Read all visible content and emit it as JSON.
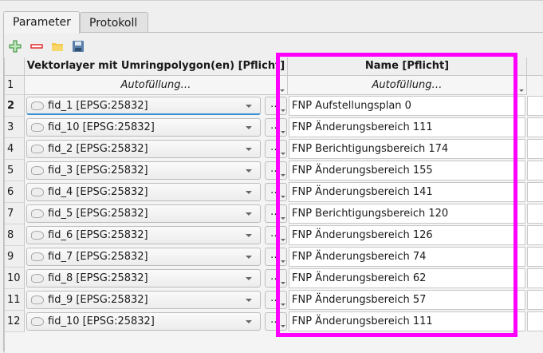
{
  "tabs": [
    {
      "label": "Parameter",
      "active": true
    },
    {
      "label": "Protokoll",
      "active": false
    }
  ],
  "toolbar": [
    {
      "icon": "add-icon",
      "color": "#3a9a3a"
    },
    {
      "icon": "remove-icon",
      "color": "#e03030"
    },
    {
      "icon": "open-folder-icon",
      "color": "#f2c94c"
    },
    {
      "icon": "save-icon",
      "color": "#5a7fa8"
    }
  ],
  "columns": [
    "Vektorlayer mit Umringpolygon(en) [Pflicht]",
    "Name [Pflicht]"
  ],
  "autofill": {
    "row_number": "1",
    "label": "Autofüllung…"
  },
  "ellipsis_label": "…",
  "highlight_color": "#ff00ff",
  "rows": [
    {
      "n": "2",
      "layer": "fid_1 [EPSG:25832]",
      "name": "FNP Aufstellungsplan 0"
    },
    {
      "n": "3",
      "layer": "fid_10 [EPSG:25832]",
      "name": "FNP Änderungsbereich 111"
    },
    {
      "n": "4",
      "layer": "fid_2 [EPSG:25832]",
      "name": "FNP Berichtigungsbereich 174"
    },
    {
      "n": "5",
      "layer": "fid_3 [EPSG:25832]",
      "name": "FNP Änderungsbereich 155"
    },
    {
      "n": "6",
      "layer": "fid_4 [EPSG:25832]",
      "name": "FNP Änderungsbereich 141"
    },
    {
      "n": "7",
      "layer": "fid_5 [EPSG:25832]",
      "name": "FNP Berichtigungsbereich 120"
    },
    {
      "n": "8",
      "layer": "fid_6 [EPSG:25832]",
      "name": "FNP Änderungsbereich 126"
    },
    {
      "n": "9",
      "layer": "fid_7 [EPSG:25832]",
      "name": "FNP Änderungsbereich 74"
    },
    {
      "n": "10",
      "layer": "fid_8 [EPSG:25832]",
      "name": "FNP Änderungsbereich 62"
    },
    {
      "n": "11",
      "layer": "fid_9 [EPSG:25832]",
      "name": "FNP Änderungsbereich 57"
    },
    {
      "n": "12",
      "layer": "fid_10 [EPSG:25832]",
      "name": "FNP Änderungsbereich 111"
    }
  ]
}
